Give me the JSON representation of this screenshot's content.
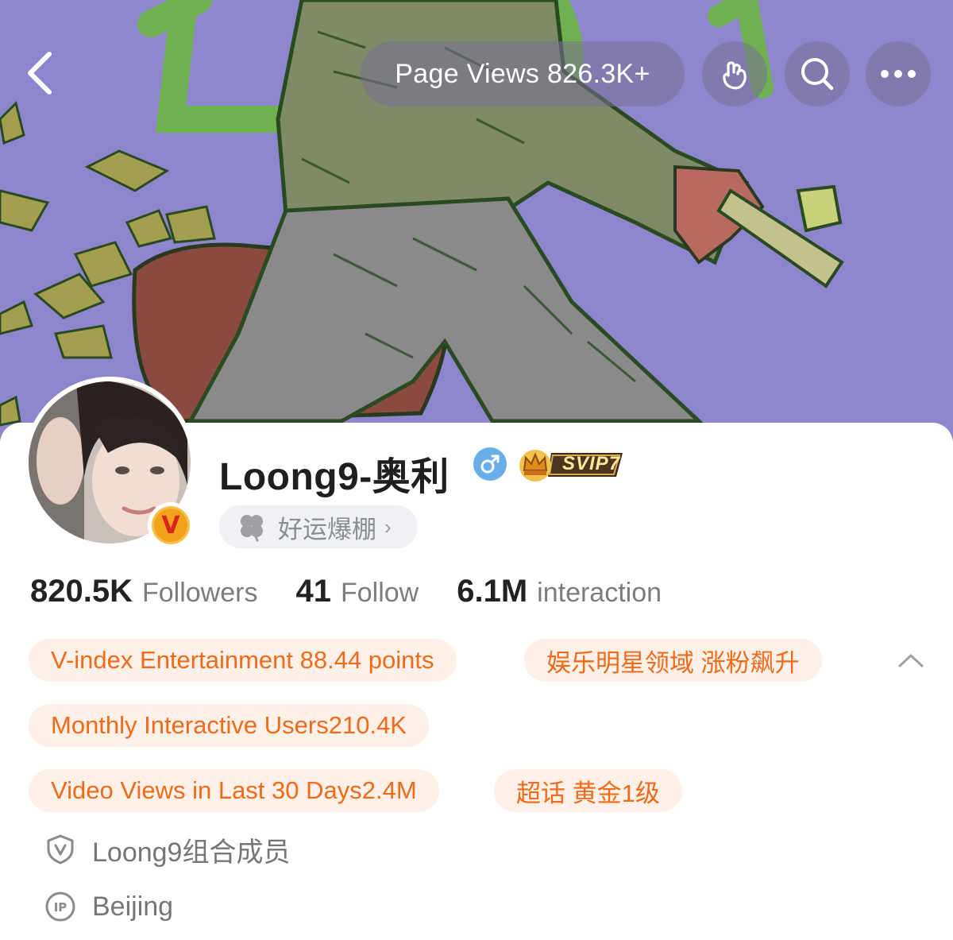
{
  "header": {
    "page_views": "Page Views 826.3K+",
    "icons": [
      "back-arrow-icon",
      "gesture-hand-icon",
      "search-icon",
      "more-dots-icon"
    ]
  },
  "profile": {
    "username": "Loong9-奥利",
    "gender": "male",
    "vip_badge": "SVIP7",
    "status_pill": "好运爆棚",
    "verified_badge": "V"
  },
  "stats": [
    {
      "value": "820.5K",
      "label": "Followers"
    },
    {
      "value": "41",
      "label": "Follow"
    },
    {
      "value": "6.1M",
      "label": "interaction"
    }
  ],
  "tags": [
    "V-index Entertainment 88.44 points",
    "娱乐明星领域 涨粉飙升",
    "Monthly Interactive Users210.4K",
    "Video Views in Last 30 Days2.4M",
    "超话 黄金1级"
  ],
  "info": {
    "verification": "Loong9组合成员",
    "ip_location": "Beijing"
  },
  "colors": {
    "cover_bg": "#8e86cc",
    "tag_bg": "#fff1e8",
    "tag_text": "#f06a1a",
    "gender_blue": "#6aaee9"
  }
}
